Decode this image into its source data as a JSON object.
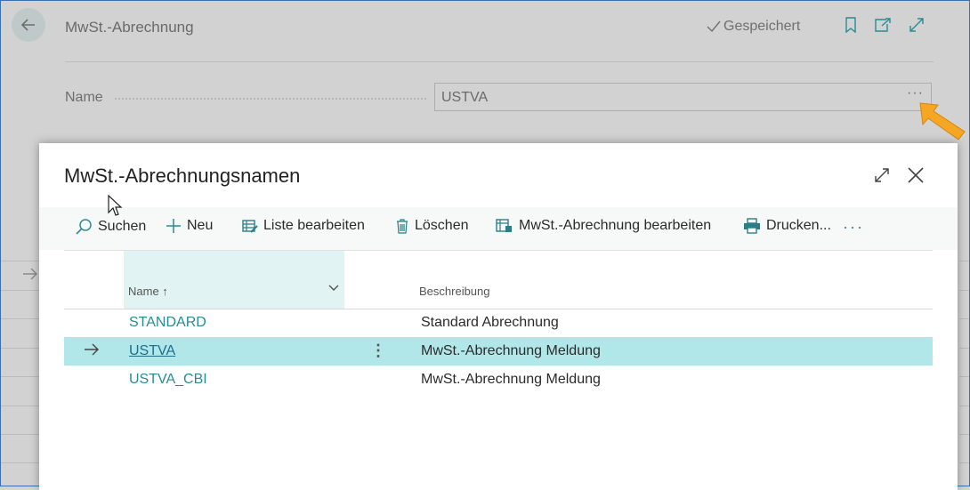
{
  "page": {
    "title": "MwSt.-Abrechnung",
    "saved_status": "Gespeichert",
    "name_label": "Name",
    "name_value": "USTVA",
    "assist_glyph": "···",
    "icons": [
      "back-arrow-icon",
      "bookmark-icon",
      "open-new-window-icon",
      "expand-icon"
    ]
  },
  "dialog": {
    "title": "MwSt.-Abrechnungsnamen",
    "toolbar": {
      "search": "Suchen",
      "new": "Neu",
      "edit_list": "Liste bearbeiten",
      "delete": "Löschen",
      "edit_vat": "MwSt.-Abrechnung bearbeiten",
      "print": "Drucken...",
      "more": "···"
    },
    "columns": {
      "name": "Name ↑",
      "description": "Beschreibung"
    },
    "rows": [
      {
        "name": "STANDARD",
        "description": "Standard Abrechnung",
        "selected": false
      },
      {
        "name": "USTVA",
        "description": "MwSt.-Abrechnung Meldung",
        "selected": true
      },
      {
        "name": "USTVA_CBI",
        "description": "MwSt.-Abrechnung Meldung",
        "selected": false
      }
    ]
  },
  "colors": {
    "accent": "#2a8c93",
    "selected_row": "#b2e7ea",
    "column_highlight": "#e2f3f4",
    "hint_arrow": "#f5a623"
  }
}
